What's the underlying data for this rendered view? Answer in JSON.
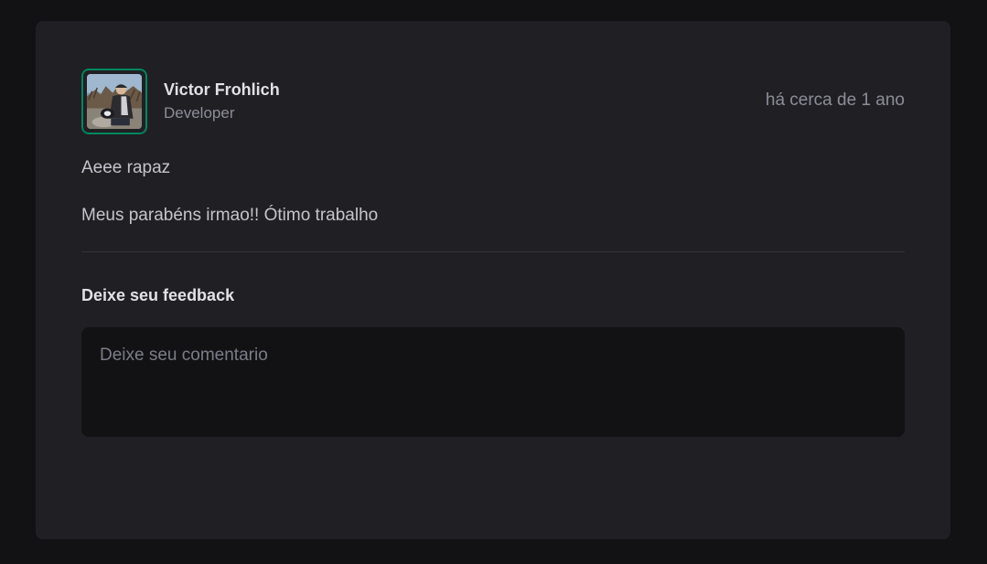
{
  "post": {
    "author": {
      "name": "Victor Frohlich",
      "role": "Developer",
      "avatar_icon": "avatar-photo"
    },
    "published": "há cerca de 1 ano",
    "content": [
      "Aeee rapaz",
      "Meus parabéns irmao!! Ótimo trabalho"
    ],
    "feedback": {
      "title": "Deixe seu feedback",
      "placeholder": "Deixe seu comentario",
      "value": ""
    }
  },
  "colors": {
    "page_bg": "#121214",
    "card_bg": "#202024",
    "accent": "#00875f",
    "text_primary": "#e1e1e6",
    "text_muted": "#8d8d99"
  }
}
